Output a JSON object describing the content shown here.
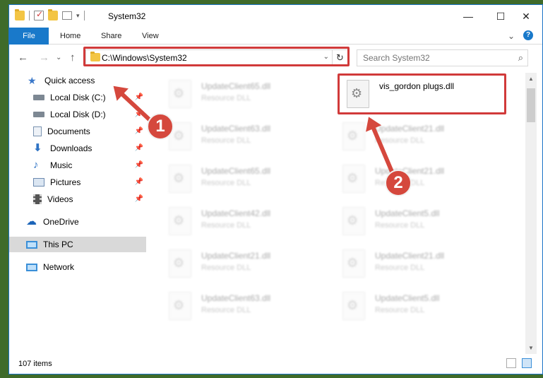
{
  "window": {
    "title": "System32",
    "minimize": "—",
    "maximize": "☐",
    "close": "✕"
  },
  "ribbon": {
    "tabs": [
      "File",
      "Home",
      "Share",
      "View"
    ],
    "collapse": "⌄",
    "help": "?"
  },
  "navigation": {
    "back": "←",
    "forward": "→",
    "recent": "⌄",
    "up": "↑"
  },
  "address": {
    "path": "C:\\Windows\\System32",
    "dropdown": "⌄",
    "refresh": "↻"
  },
  "search": {
    "placeholder": "Search System32",
    "icon": "⌕"
  },
  "sidebar": {
    "items": [
      {
        "label": "Quick access",
        "icon": "star-icon",
        "color": "#3a78c9"
      },
      {
        "label": "Local Disk (C:)",
        "icon": "drive-icon",
        "color": "#7d8893"
      },
      {
        "label": "Local Disk (D:)",
        "icon": "drive-icon",
        "color": "#7d8893"
      },
      {
        "label": "Documents",
        "icon": "documents-icon",
        "color": "#7a93b0"
      },
      {
        "label": "Downloads",
        "icon": "download-icon",
        "color": "#2f73c4"
      },
      {
        "label": "Music",
        "icon": "music-icon",
        "color": "#2f73c4"
      },
      {
        "label": "Pictures",
        "icon": "pictures-icon",
        "color": "#6c8ab0"
      },
      {
        "label": "Videos",
        "icon": "videos-icon",
        "color": "#555555"
      },
      {
        "label": "OneDrive",
        "icon": "cloud-icon",
        "color": "#1c64b8"
      },
      {
        "label": "This PC",
        "icon": "computer-icon",
        "color": "#3a8fd8"
      },
      {
        "label": "Network",
        "icon": "network-icon",
        "color": "#3a8fd8"
      }
    ]
  },
  "files": {
    "highlighted": {
      "name": "vis_gordon plugs.dll",
      "type": ""
    },
    "left_column": [
      {
        "name": "UpdateClient65.dll",
        "type": "Resource DLL"
      },
      {
        "name": "UpdateClient63.dll",
        "type": "Resource DLL"
      },
      {
        "name": "UpdateClient65.dll",
        "type": "Resource DLL"
      },
      {
        "name": "UpdateClient42.dll",
        "type": "Resource DLL"
      },
      {
        "name": "UpdateClient21.dll",
        "type": "Resource DLL"
      },
      {
        "name": "UpdateClient63.dll",
        "type": "Resource DLL"
      }
    ],
    "right_column": [
      {
        "name": "UpdateClient21.dll",
        "type": "Resource DLL"
      },
      {
        "name": "UpdateClient21.dll",
        "type": "Resource DLL"
      },
      {
        "name": "UpdateClient5.dll",
        "type": "Resource DLL"
      },
      {
        "name": "UpdateClient21.dll",
        "type": "Resource DLL"
      },
      {
        "name": "UpdateClient5.dll",
        "type": "Resource DLL"
      }
    ]
  },
  "status": {
    "item_count": "107 items"
  },
  "annotations": {
    "step1": "1",
    "step2": "2",
    "color": "#d5483d"
  }
}
